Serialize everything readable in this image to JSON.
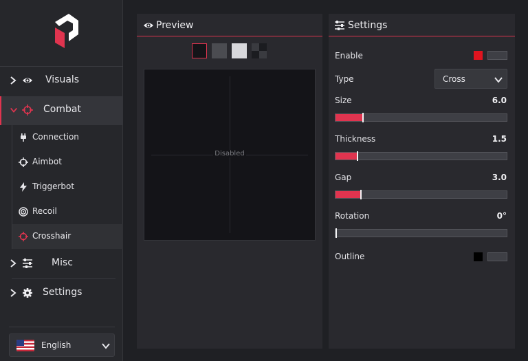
{
  "sidebar": {
    "items": [
      {
        "label": "Visuals",
        "icon": "eye-icon"
      },
      {
        "label": "Combat",
        "icon": "crosshair-icon",
        "expanded": true
      },
      {
        "label": "Misc",
        "icon": "sliders-icon"
      },
      {
        "label": "Settings",
        "icon": "gear-icon"
      }
    ],
    "subitems": [
      {
        "label": "Connection",
        "icon": "plug-icon"
      },
      {
        "label": "Aimbot",
        "icon": "target-icon"
      },
      {
        "label": "Triggerbot",
        "icon": "lightning-icon"
      },
      {
        "label": "Recoil",
        "icon": "bullseye-icon"
      },
      {
        "label": "Crosshair",
        "icon": "crosshair-icon",
        "active": true
      }
    ],
    "language": {
      "label": "English",
      "icon": "us-flag-icon"
    }
  },
  "preview": {
    "title": "Preview",
    "status": "Disabled",
    "swatches": [
      "#141418",
      "#4b4c51",
      "#d8d8dc",
      "checker"
    ]
  },
  "settings": {
    "title": "Settings",
    "enable": {
      "label": "Enable",
      "color": "#e0141f",
      "on": false
    },
    "type": {
      "label": "Type",
      "value": "Cross"
    },
    "size": {
      "label": "Size",
      "value": "6.0",
      "fraction": 0.16
    },
    "thickness": {
      "label": "Thickness",
      "value": "1.5",
      "fraction": 0.13
    },
    "gap": {
      "label": "Gap",
      "value": "3.0",
      "fraction": 0.15
    },
    "rotation": {
      "label": "Rotation",
      "value": "0°",
      "fraction": 0.0
    },
    "outline": {
      "label": "Outline",
      "color": "#000000",
      "on": false
    }
  },
  "colors": {
    "accent": "#e0344f",
    "background": "#1f2024",
    "panel": "#29292e"
  }
}
